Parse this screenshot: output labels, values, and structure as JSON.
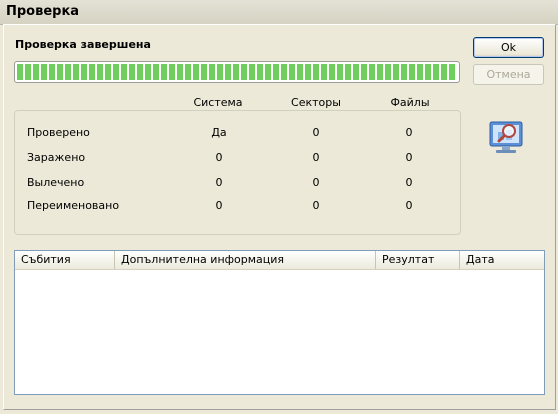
{
  "window": {
    "title": "Проверка"
  },
  "status": {
    "text": "Проверка завершена",
    "progress_percent": 100
  },
  "buttons": {
    "ok_label": "Ok",
    "cancel_label": "Отмена"
  },
  "stats": {
    "columns": [
      "Система",
      "Секторы",
      "Файлы"
    ],
    "rows": [
      {
        "label": "Проверено",
        "values": [
          "Да",
          "0",
          "0"
        ]
      },
      {
        "label": "Заражено",
        "values": [
          "0",
          "0",
          "0"
        ]
      },
      {
        "label": "Вылечено",
        "values": [
          "0",
          "0",
          "0"
        ]
      },
      {
        "label": "Переименовано",
        "values": [
          "0",
          "0",
          "0"
        ]
      }
    ]
  },
  "icons": {
    "scan": "monitor-magnifier-icon"
  },
  "events_list": {
    "columns": [
      "Събития",
      "Допълнителна информация",
      "Резултат",
      "Дата"
    ],
    "rows": []
  },
  "colors": {
    "progress_fill": "#6fcf5c",
    "window_bg": "#ece9d8"
  }
}
